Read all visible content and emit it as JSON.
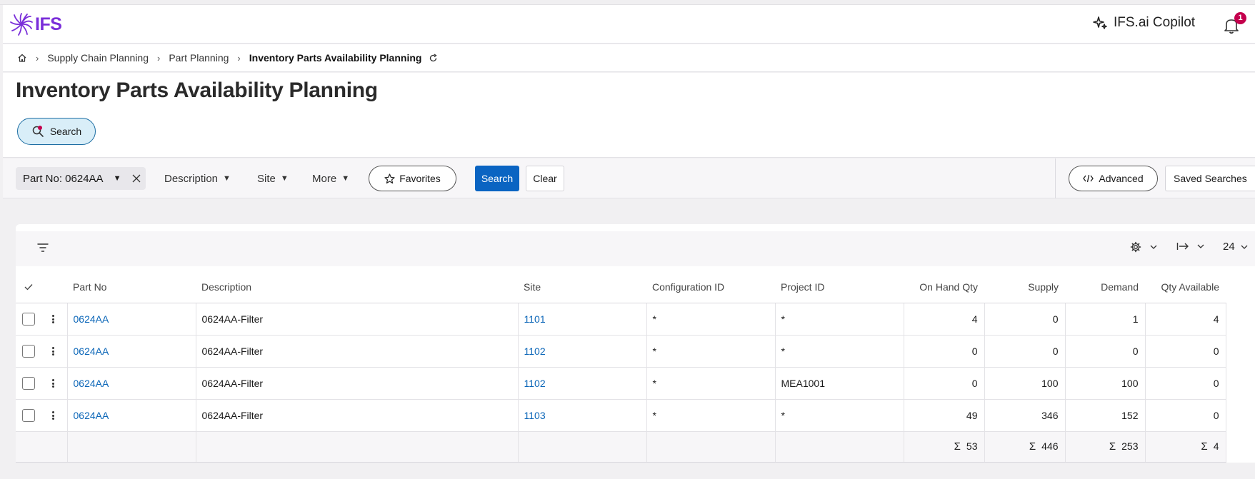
{
  "app": {
    "logo_text": "IFS",
    "copilot_label": "IFS.ai Copilot",
    "notification_count": "1",
    "brand_color": "#7a2ed9"
  },
  "breadcrumb": {
    "items": [
      "Supply Chain Planning",
      "Part Planning"
    ],
    "current": "Inventory Parts Availability Planning"
  },
  "page": {
    "title": "Inventory Parts Availability Planning",
    "search_toggle_label": "Search"
  },
  "filters": {
    "chip_label": "Part No: 0624AA",
    "dropdowns": [
      "Description",
      "Site",
      "More"
    ],
    "favorites_label": "Favorites",
    "search_label": "Search",
    "clear_label": "Clear",
    "advanced_label": "Advanced",
    "saved_searches_label": "Saved Searches"
  },
  "grid": {
    "page_size": "24",
    "columns": [
      "Part No",
      "Description",
      "Site",
      "Configuration ID",
      "Project ID",
      "On Hand Qty",
      "Supply",
      "Demand",
      "Qty Available"
    ],
    "rows": [
      {
        "part_no": "0624AA",
        "description": "0624AA-Filter",
        "site": "1101",
        "config_id": "*",
        "project_id": "*",
        "on_hand": "4",
        "supply": "0",
        "demand": "1",
        "qty_available": "4"
      },
      {
        "part_no": "0624AA",
        "description": "0624AA-Filter",
        "site": "1102",
        "config_id": "*",
        "project_id": "*",
        "on_hand": "0",
        "supply": "0",
        "demand": "0",
        "qty_available": "0"
      },
      {
        "part_no": "0624AA",
        "description": "0624AA-Filter",
        "site": "1102",
        "config_id": "*",
        "project_id": "MEA1001",
        "on_hand": "0",
        "supply": "100",
        "demand": "100",
        "qty_available": "0"
      },
      {
        "part_no": "0624AA",
        "description": "0624AA-Filter",
        "site": "1103",
        "config_id": "*",
        "project_id": "*",
        "on_hand": "49",
        "supply": "346",
        "demand": "152",
        "qty_available": "0"
      }
    ],
    "totals": {
      "sigma": "Σ",
      "on_hand": "53",
      "supply": "446",
      "demand": "253",
      "qty_available": "4"
    }
  }
}
